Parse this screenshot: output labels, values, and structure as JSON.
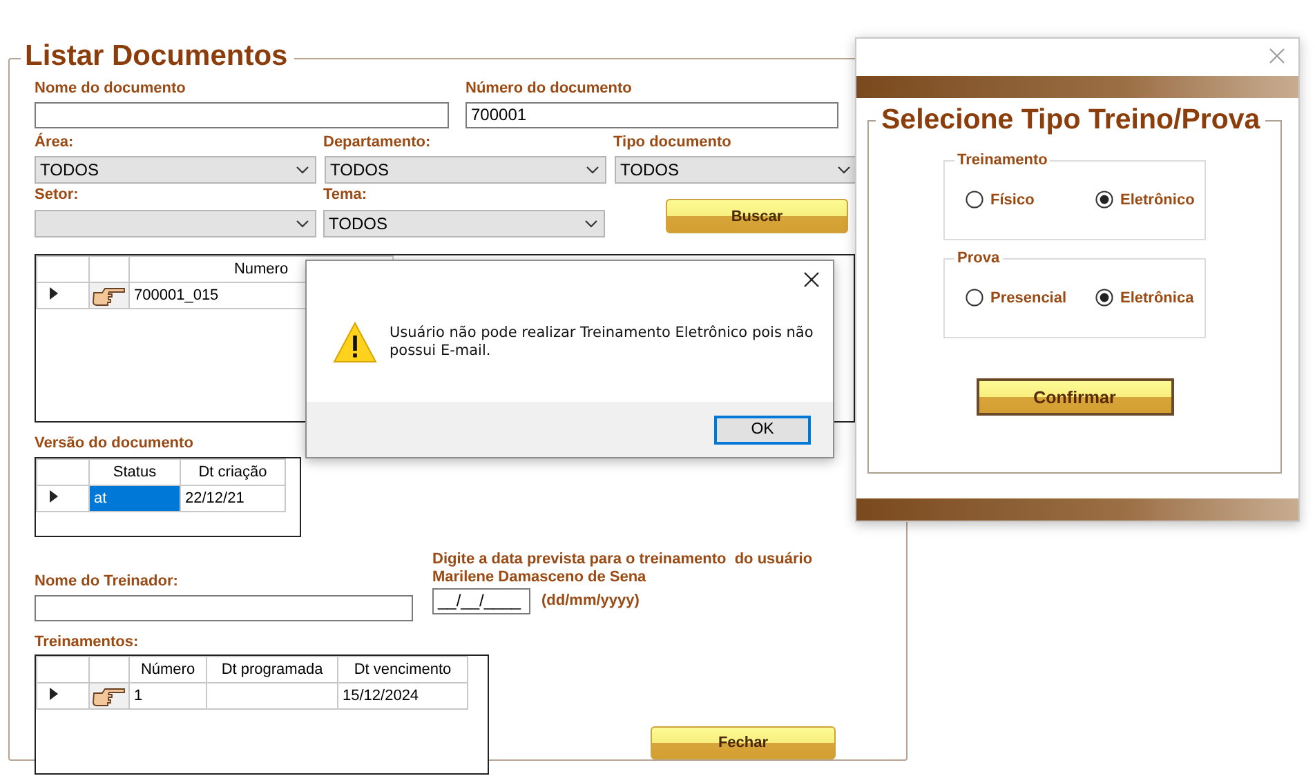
{
  "main_form": {
    "title": "Listar Documentos",
    "document_name": {
      "label": "Nome do documento"
    },
    "document_number": {
      "label": "Número do documento",
      "value": "700001"
    },
    "filters": [
      {
        "label": "Área:",
        "value": "TODOS"
      },
      {
        "label": "Departamento:",
        "value": "TODOS"
      },
      {
        "label": "Tipo documento",
        "value": "TODOS"
      },
      {
        "label": "Setor:"
      },
      {
        "label": "Tema:",
        "value": "TODOS"
      }
    ],
    "search_button": "Buscar",
    "documents_table": {
      "columns": [
        "Numero"
      ],
      "rows": [
        {
          "current": true,
          "numero": "700001_015"
        }
      ]
    },
    "version": {
      "title": "Versão do documento",
      "columns": [
        "Status",
        "Dt criação"
      ],
      "rows": [
        {
          "current": true,
          "cells": [
            {
              "text": "at",
              "selected": true
            },
            {
              "text": "22/12/21",
              "selected": false
            }
          ]
        }
      ]
    },
    "trainer": {
      "label": "Nome do Treinador:"
    },
    "date_prompt": {
      "lines": [
        "Digite a data prevista para o treinamento  do usuário",
        "Marilene Damasceno de Sena"
      ],
      "value": "__/__/____",
      "format": "(dd/mm/yyyy)"
    },
    "trainings": {
      "title": "Treinamentos:",
      "columns": [
        "Número",
        "Dt programada",
        "Dt vencimento"
      ],
      "rows": [
        {
          "current": true,
          "numero": "1",
          "dt_vencimento": "15/12/2024"
        }
      ]
    },
    "close_button": "Fechar"
  },
  "message_box": {
    "lines": [
      "Usuário não pode realizar Treinamento Eletrônico pois não",
      "possui E-mail."
    ],
    "ok_button": "OK"
  },
  "type_dialog": {
    "title": "Selecione Tipo Treino/Prova",
    "groups": [
      {
        "title": "Treinamento",
        "options": [
          {
            "label": "Físico",
            "selected": false
          },
          {
            "label": "Eletrônico",
            "selected": true
          }
        ]
      },
      {
        "title": "Prova",
        "options": [
          {
            "label": "Presencial",
            "selected": false
          },
          {
            "label": "Eletrônica",
            "selected": true
          }
        ]
      }
    ],
    "confirm_button": "Confirmar"
  }
}
